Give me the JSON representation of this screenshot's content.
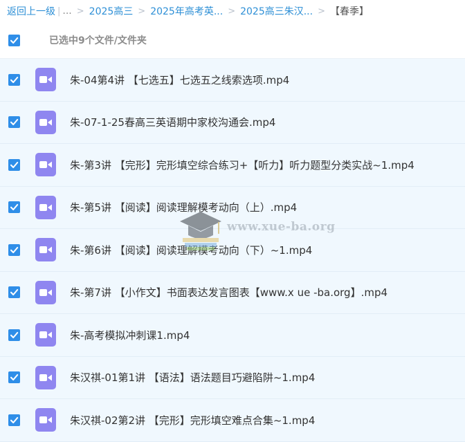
{
  "breadcrumb": {
    "back_label": "返回上一级",
    "bar": "|",
    "ellipsis": "...",
    "separator": ">",
    "items": [
      "2025高三",
      "2025年高考英...",
      "2025高三朱汉..."
    ],
    "current": "【春季】"
  },
  "selection": {
    "label": "已选中9个文件/文件夹"
  },
  "files": [
    {
      "name": "朱-04第4讲 【七选五】七选五之线索选项.mp4",
      "icon": "video-file-icon"
    },
    {
      "name": "朱-07-1-25春高三英语期中家校沟通会.mp4",
      "icon": "video-file-icon"
    },
    {
      "name": "朱-第3讲 【完形】完形填空综合练习+【听力】听力题型分类实战~1.mp4",
      "icon": "video-file-icon"
    },
    {
      "name": "朱-第5讲 【阅读】阅读理解模考动向（上）.mp4",
      "icon": "video-file-icon"
    },
    {
      "name": "朱-第6讲 【阅读】阅读理解模考动向（下）~1.mp4",
      "icon": "video-file-icon"
    },
    {
      "name": "朱-第7讲 【小作文】书面表达发言图表【www.x ue -ba.org】.mp4",
      "icon": "video-file-icon"
    },
    {
      "name": "朱-高考模拟冲刺课1.mp4",
      "icon": "video-file-icon"
    },
    {
      "name": "朱汉祺-01第1讲 【语法】语法题目巧避陷阱~1.mp4",
      "icon": "video-file-icon"
    },
    {
      "name": "朱汉祺-02第2讲 【完形】完形填空难点合集~1.mp4",
      "icon": "video-file-icon"
    }
  ],
  "watermark": {
    "text": "www.xue-ba.org"
  },
  "colors": {
    "accent": "#2f8ee8",
    "link": "#2d8fd6",
    "row_bg": "#f0f8fe",
    "video_icon": "#8f86f0"
  }
}
